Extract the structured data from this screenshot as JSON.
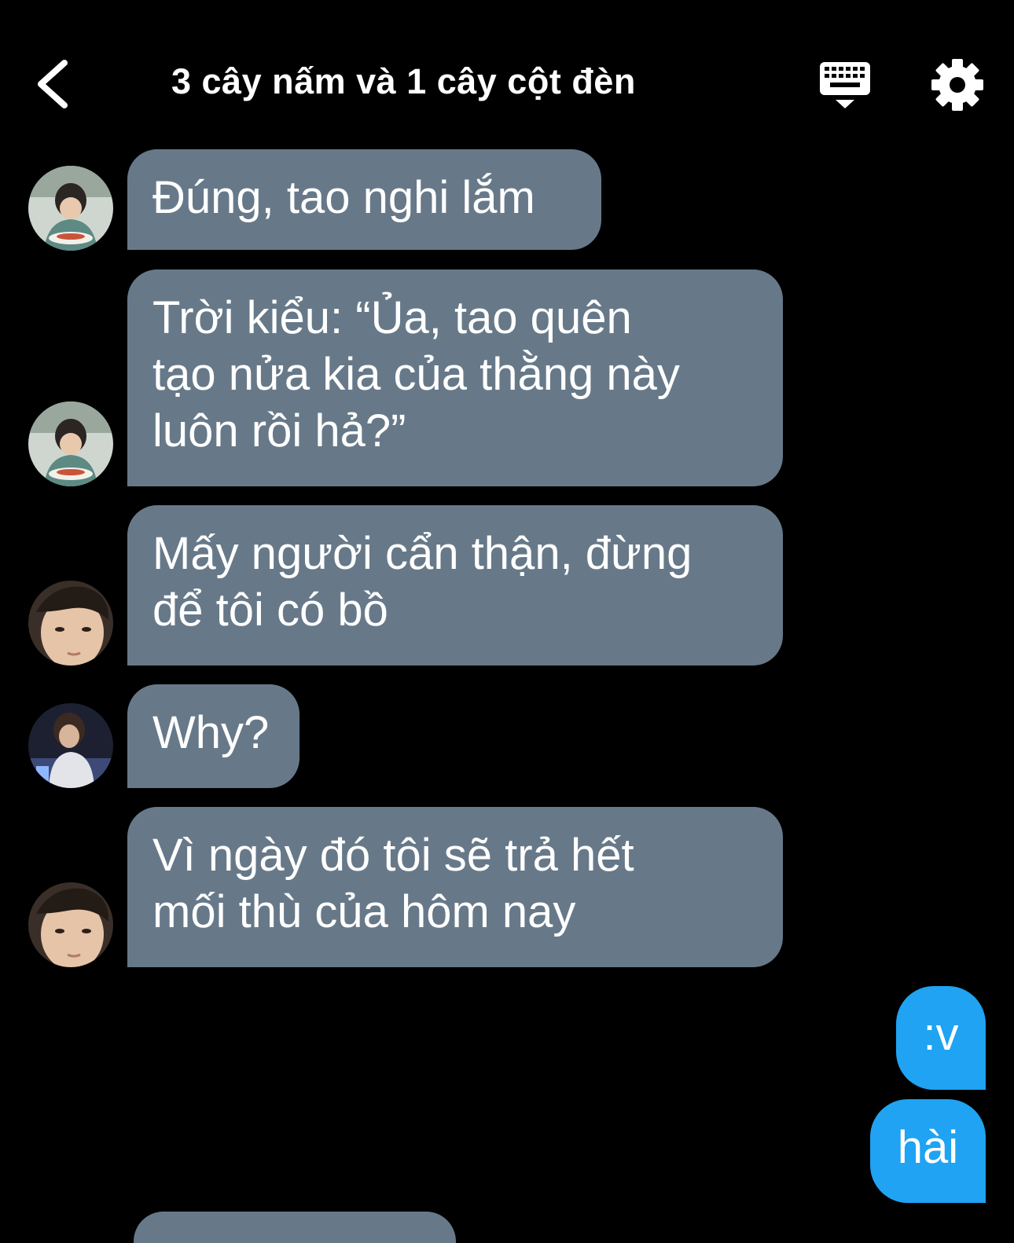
{
  "header": {
    "title": "3 cây nấm và 1 cây cột đèn",
    "back_icon": "chevron-left-icon",
    "keyboard_icon": "keyboard-icon",
    "settings_icon": "gear-icon"
  },
  "messages": [
    {
      "sender": "incoming",
      "avatar": "avatar-a",
      "text": "Đúng, tao nghi lắm"
    },
    {
      "sender": "incoming",
      "avatar": "avatar-a",
      "text": "Trời kiểu: “Ủa, tao quên\ntạo nửa kia của thằng này\nluôn rồi hả?”"
    },
    {
      "sender": "incoming",
      "avatar": "avatar-b",
      "text": "Mấy người cẩn thận, đừng\nđể tôi có bồ"
    },
    {
      "sender": "incoming",
      "avatar": "avatar-c",
      "text": "Why?"
    },
    {
      "sender": "incoming",
      "avatar": "avatar-b",
      "text": "Vì ngày đó tôi sẽ trả hết\nmối thù của hôm nay"
    },
    {
      "sender": "outgoing",
      "text": ":v"
    },
    {
      "sender": "outgoing",
      "text": "hài"
    }
  ],
  "colors": {
    "background": "#000000",
    "incoming_bubble": "#677989",
    "outgoing_bubble": "#1fa3f2",
    "text": "#ffffff"
  }
}
